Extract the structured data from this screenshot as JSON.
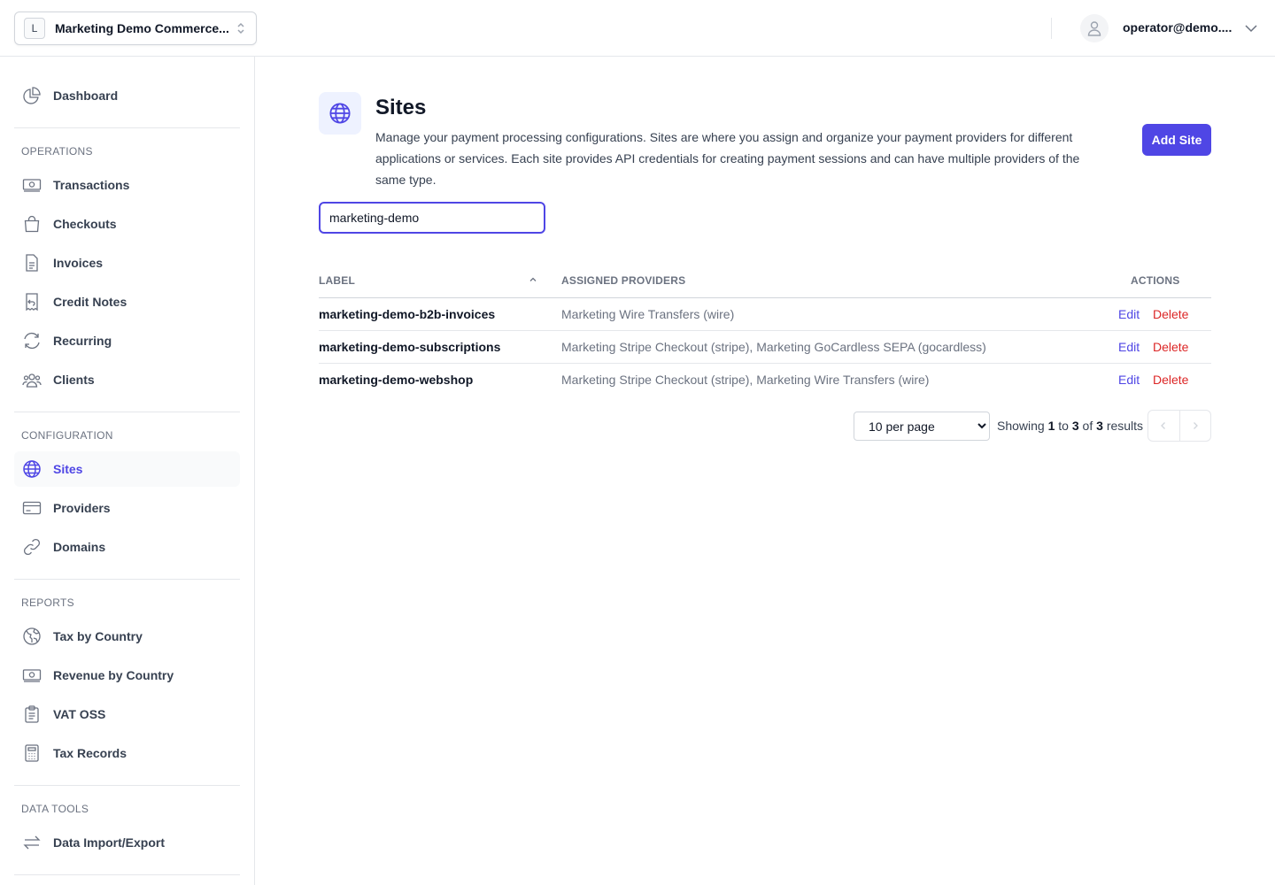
{
  "topbar": {
    "org_initial": "L",
    "org_name": "Marketing Demo Commerce...",
    "user_email": "operator@demo...."
  },
  "sidebar": {
    "dashboard": "Dashboard",
    "sections": {
      "operations": "OPERATIONS",
      "configuration": "CONFIGURATION",
      "reports": "REPORTS",
      "data_tools": "DATA TOOLS"
    },
    "operations": [
      "Transactions",
      "Checkouts",
      "Invoices",
      "Credit Notes",
      "Recurring",
      "Clients"
    ],
    "configuration": [
      "Sites",
      "Providers",
      "Domains"
    ],
    "reports": [
      "Tax by Country",
      "Revenue by Country",
      "VAT OSS",
      "Tax Records"
    ],
    "data_tools": [
      "Data Import/Export"
    ],
    "active_item": "Sites"
  },
  "page": {
    "title": "Sites",
    "description": "Manage your payment processing configurations. Sites are where you assign and organize your payment providers for different applications or services. Each site provides API credentials for creating payment sessions and can have multiple providers of the same type.",
    "add_button": "Add Site"
  },
  "search": {
    "value": "marketing-demo"
  },
  "table": {
    "headers": {
      "label": "LABEL",
      "providers": "ASSIGNED PROVIDERS",
      "actions": "ACTIONS"
    },
    "rows": [
      {
        "label": "marketing-demo-b2b-invoices",
        "providers": "Marketing Wire Transfers (wire)",
        "edit": "Edit",
        "delete": "Delete"
      },
      {
        "label": "marketing-demo-subscriptions",
        "providers": "Marketing Stripe Checkout (stripe), Marketing GoCardless SEPA (gocardless)",
        "edit": "Edit",
        "delete": "Delete"
      },
      {
        "label": "marketing-demo-webshop",
        "providers": "Marketing Stripe Checkout (stripe), Marketing Wire Transfers (wire)",
        "edit": "Edit",
        "delete": "Delete"
      }
    ]
  },
  "pagination": {
    "per_page": "10 per page",
    "showing_prefix": "Showing",
    "from": "1",
    "to_word": "to",
    "to": "3",
    "of_word": "of",
    "total": "3",
    "results_word": "results"
  },
  "colors": {
    "accent": "#4f46e5",
    "danger": "#dc2626"
  }
}
